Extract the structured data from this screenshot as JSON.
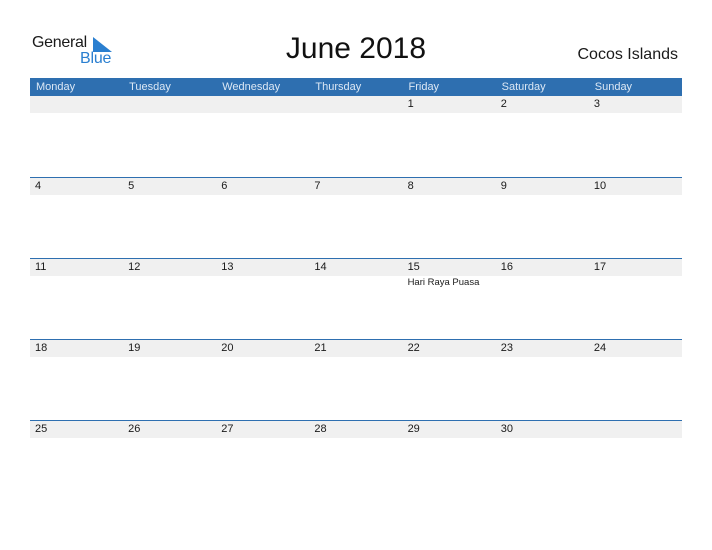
{
  "logo": {
    "line1": "General",
    "line2": "Blue",
    "icon": "triangle-flag-icon"
  },
  "title": "June 2018",
  "country": "Cocos Islands",
  "weekdays": [
    "Monday",
    "Tuesday",
    "Wednesday",
    "Thursday",
    "Friday",
    "Saturday",
    "Sunday"
  ],
  "weeks": [
    {
      "days": [
        {
          "num": "",
          "event": ""
        },
        {
          "num": "",
          "event": ""
        },
        {
          "num": "",
          "event": ""
        },
        {
          "num": "",
          "event": ""
        },
        {
          "num": "1",
          "event": ""
        },
        {
          "num": "2",
          "event": ""
        },
        {
          "num": "3",
          "event": ""
        }
      ]
    },
    {
      "days": [
        {
          "num": "4",
          "event": ""
        },
        {
          "num": "5",
          "event": ""
        },
        {
          "num": "6",
          "event": ""
        },
        {
          "num": "7",
          "event": ""
        },
        {
          "num": "8",
          "event": ""
        },
        {
          "num": "9",
          "event": ""
        },
        {
          "num": "10",
          "event": ""
        }
      ]
    },
    {
      "days": [
        {
          "num": "11",
          "event": ""
        },
        {
          "num": "12",
          "event": ""
        },
        {
          "num": "13",
          "event": ""
        },
        {
          "num": "14",
          "event": ""
        },
        {
          "num": "15",
          "event": "Hari Raya Puasa"
        },
        {
          "num": "16",
          "event": ""
        },
        {
          "num": "17",
          "event": ""
        }
      ]
    },
    {
      "days": [
        {
          "num": "18",
          "event": ""
        },
        {
          "num": "19",
          "event": ""
        },
        {
          "num": "20",
          "event": ""
        },
        {
          "num": "21",
          "event": ""
        },
        {
          "num": "22",
          "event": ""
        },
        {
          "num": "23",
          "event": ""
        },
        {
          "num": "24",
          "event": ""
        }
      ]
    },
    {
      "days": [
        {
          "num": "25",
          "event": ""
        },
        {
          "num": "26",
          "event": ""
        },
        {
          "num": "27",
          "event": ""
        },
        {
          "num": "28",
          "event": ""
        },
        {
          "num": "29",
          "event": ""
        },
        {
          "num": "30",
          "event": ""
        },
        {
          "num": "",
          "event": ""
        }
      ]
    }
  ],
  "colors": {
    "accent": "#2e6fb0",
    "logo_blue": "#2a7fd0",
    "strip": "#f0f0f0"
  }
}
